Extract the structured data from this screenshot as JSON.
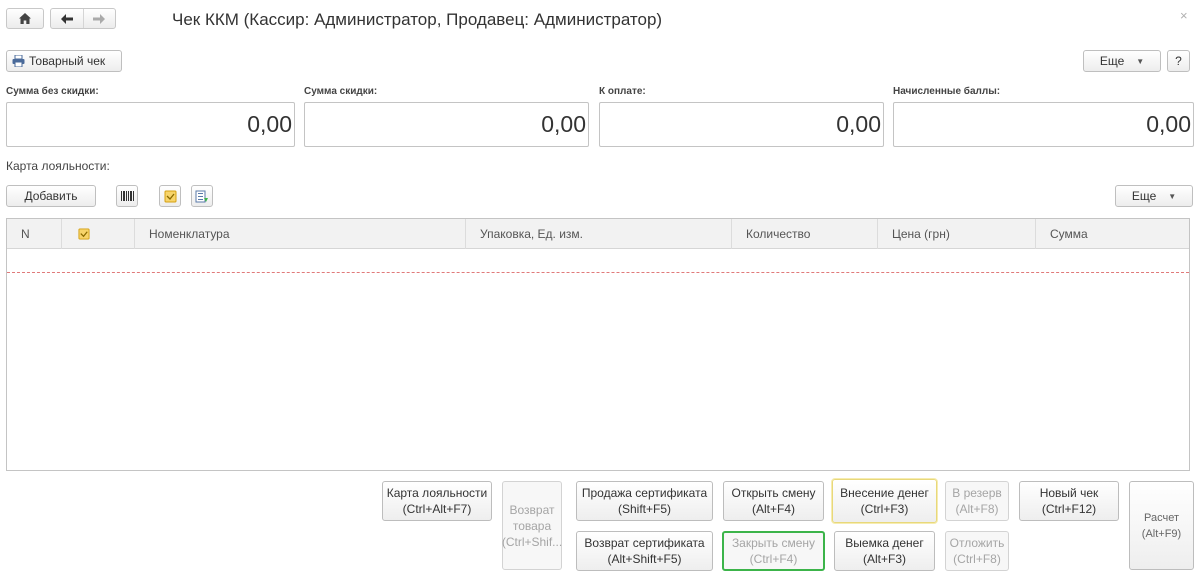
{
  "window": {
    "title": "Чек ККМ (Кассир: Администратор, Продавец: Администратор)",
    "close_glyph": "×"
  },
  "nav": {
    "home_icon": "home-icon",
    "back_icon": "arrow-left-icon",
    "forward_icon": "arrow-right-icon"
  },
  "toolbar": {
    "receipt_label": "Товарный чек",
    "more_label": "Еще",
    "help_label": "?"
  },
  "totals": [
    {
      "label": "Сумма без скидки:",
      "value": "0,00"
    },
    {
      "label": "Сумма скидки:",
      "value": "0,00"
    },
    {
      "label": "К оплате:",
      "value": "0,00"
    },
    {
      "label": "Начисленные баллы:",
      "value": "0,00"
    }
  ],
  "loyalty": {
    "label": "Карта лояльности:"
  },
  "items_toolbar": {
    "add_label": "Добавить",
    "more_label": "Еще"
  },
  "table": {
    "columns": [
      "N",
      "",
      "Номенклатура",
      "Упаковка, Ед. изм.",
      "Количество",
      "Цена (грн)",
      "Сумма"
    ],
    "rows": []
  },
  "actions": {
    "loyalty_card": {
      "line1": "Карта лояльности",
      "line2": "(Ctrl+Alt+F7)"
    },
    "return_goods": {
      "line1": "Возврат",
      "line2": "товара",
      "line3": "(Ctrl+Shif..."
    },
    "sell_certificate": {
      "line1": "Продажа сертификата",
      "line2": "(Shift+F5)"
    },
    "return_certificate": {
      "line1": "Возврат сертификата",
      "line2": "(Alt+Shift+F5)"
    },
    "open_shift": {
      "line1": "Открыть смену",
      "line2": "(Alt+F4)"
    },
    "close_shift": {
      "line1": "Закрыть смену",
      "line2": "(Ctrl+F4)"
    },
    "cash_in": {
      "line1": "Внесение денег",
      "line2": "(Ctrl+F3)"
    },
    "cash_out": {
      "line1": "Выемка денег",
      "line2": "(Alt+F3)"
    },
    "reserve": {
      "line1": "В резерв",
      "line2": "(Alt+F8)"
    },
    "postpone": {
      "line1": "Отложить",
      "line2": "(Ctrl+F8)"
    },
    "new_receipt": {
      "line1": "Новый чек",
      "line2": "(Ctrl+F12)"
    },
    "payment": {
      "line1": "Расчет",
      "line2": "(Alt+F9)"
    }
  },
  "colors": {
    "accent_green": "#3cb44a",
    "accent_yellow": "#e8d87a",
    "icon_orange": "#f2a516"
  }
}
